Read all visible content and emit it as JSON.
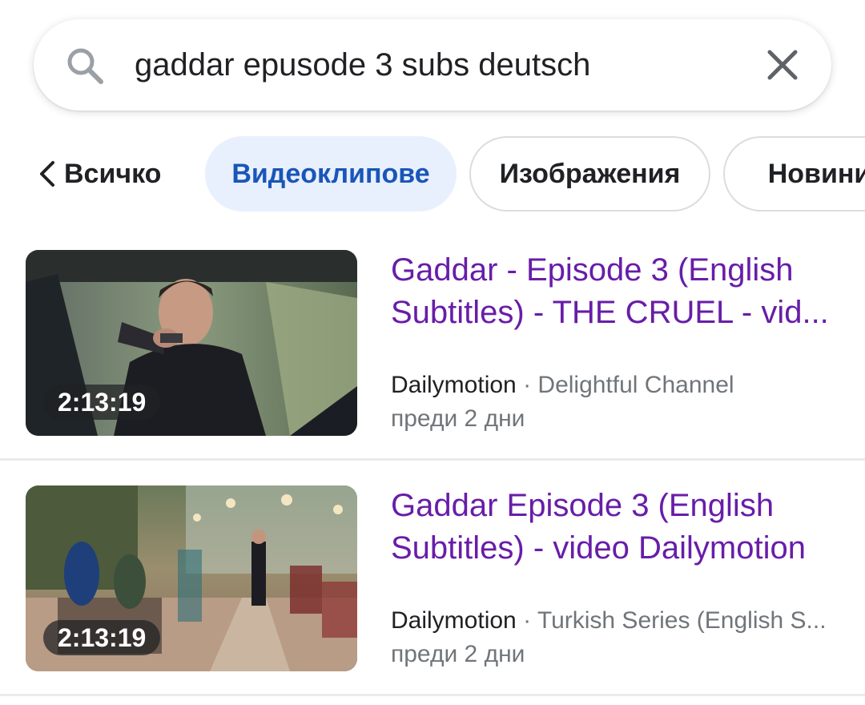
{
  "search": {
    "query": "gaddar epusode 3 subs deutsch",
    "search_icon": "search-icon",
    "clear_icon": "close-icon"
  },
  "filters": {
    "back_label": "Всичко",
    "chips": [
      {
        "label": "Видеоклипове",
        "active": true
      },
      {
        "label": "Изображения",
        "active": false
      },
      {
        "label": "Новини",
        "active": false
      }
    ]
  },
  "results": [
    {
      "title_line1": "Gaddar - Episode 3 (English",
      "title_line2": "Subtitles) - THE CRUEL - vid...",
      "source": "Dailymotion",
      "separator": " · ",
      "channel": "Delightful Channel",
      "age": "преди 2 дни",
      "duration": "2:13:19"
    },
    {
      "title_line1": "Gaddar Episode 3 (English",
      "title_line2": "Subtitles) - video Dailymotion",
      "source": "Dailymotion",
      "separator": " · ",
      "channel": "Turkish Series (English S...",
      "age": "преди 2 дни",
      "duration": "2:13:19"
    }
  ],
  "colors": {
    "link_visited": "#681da8",
    "chip_active_bg": "#e8f0fe",
    "chip_active_text": "#1a56b8",
    "secondary_text": "#70757a"
  }
}
